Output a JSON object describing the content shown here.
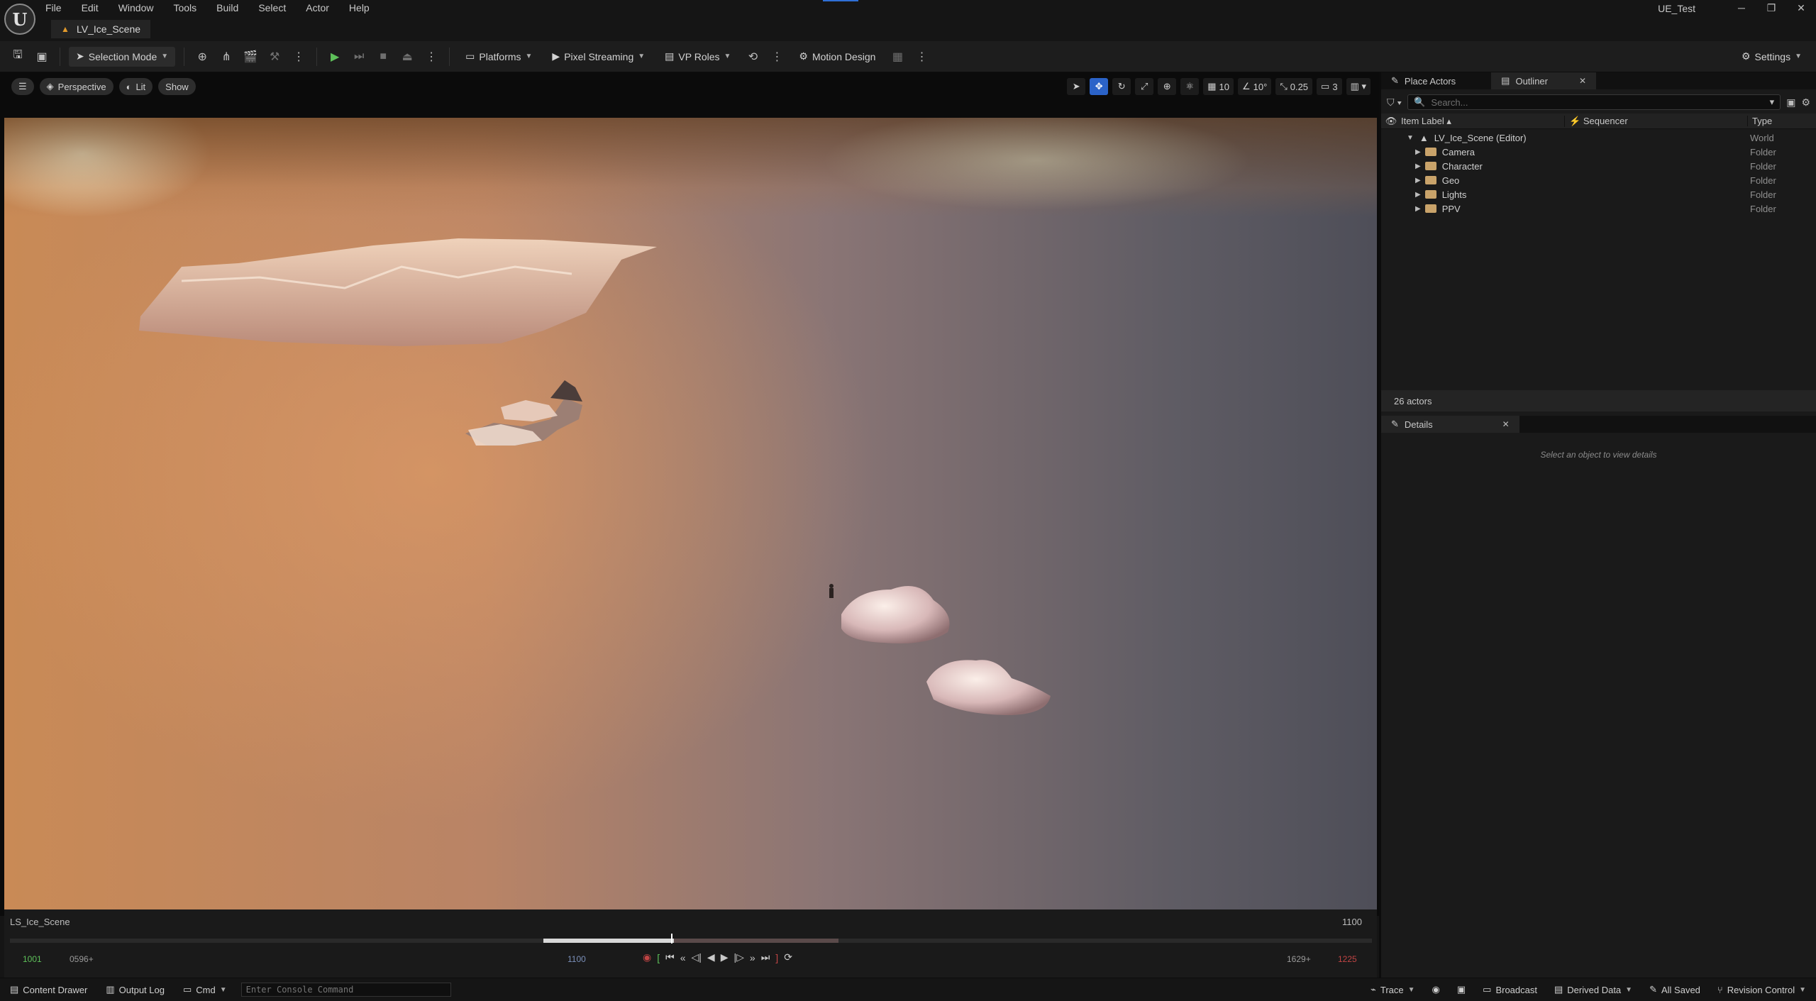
{
  "app": {
    "project_name": "UE_Test",
    "document_tab": "LV_Ice_Scene",
    "menu": [
      "File",
      "Edit",
      "Window",
      "Tools",
      "Build",
      "Select",
      "Actor",
      "Help"
    ],
    "logo_text": "U"
  },
  "window_controls": {
    "minimize": "─",
    "restore": "❐",
    "close": "✕"
  },
  "toolbar": {
    "selection_mode": "Selection Mode",
    "platforms": "Platforms",
    "pixel_streaming": "Pixel Streaming",
    "vp_roles": "VP Roles",
    "motion_design": "Motion Design",
    "settings": "Settings"
  },
  "viewport": {
    "perspective": "Perspective",
    "lit": "Lit",
    "show": "Show",
    "grid_snap": "10",
    "rotation_snap": "10°",
    "scale_snap": "0.25",
    "camera_speed": "3"
  },
  "timeline": {
    "sequence_name": "LS_Ice_Scene",
    "current_frame": "1100",
    "start_frame": "1001",
    "view_start": "0596+",
    "playhead_frame": "1100",
    "view_end": "1629+",
    "end_frame": "1225",
    "playback_fraction": 0.6
  },
  "statusbar": {
    "content_drawer": "Content Drawer",
    "output_log": "Output Log",
    "cmd": "Cmd",
    "console_placeholder": "Enter Console Command",
    "trace": "Trace",
    "broadcast": "Broadcast",
    "derived_data": "Derived Data",
    "all_saved": "All Saved",
    "revision_control": "Revision Control"
  },
  "outliner": {
    "tab_place_actors": "Place Actors",
    "tab_outliner": "Outliner",
    "search_placeholder": "Search...",
    "col_item_label": "Item Label",
    "col_sequencer": "Sequencer",
    "col_type": "Type",
    "root": {
      "label": "LV_Ice_Scene (Editor)",
      "type": "World"
    },
    "folders": [
      {
        "label": "Camera",
        "type": "Folder"
      },
      {
        "label": "Character",
        "type": "Folder"
      },
      {
        "label": "Geo",
        "type": "Folder"
      },
      {
        "label": "Lights",
        "type": "Folder"
      },
      {
        "label": "PPV",
        "type": "Folder"
      }
    ],
    "actor_count": "26 actors"
  },
  "details": {
    "tab_label": "Details",
    "empty_hint": "Select an object to view details"
  },
  "colors": {
    "accent_blue": "#2b63c8",
    "play_green": "#5ec05a",
    "folder": "#c9a36a"
  }
}
